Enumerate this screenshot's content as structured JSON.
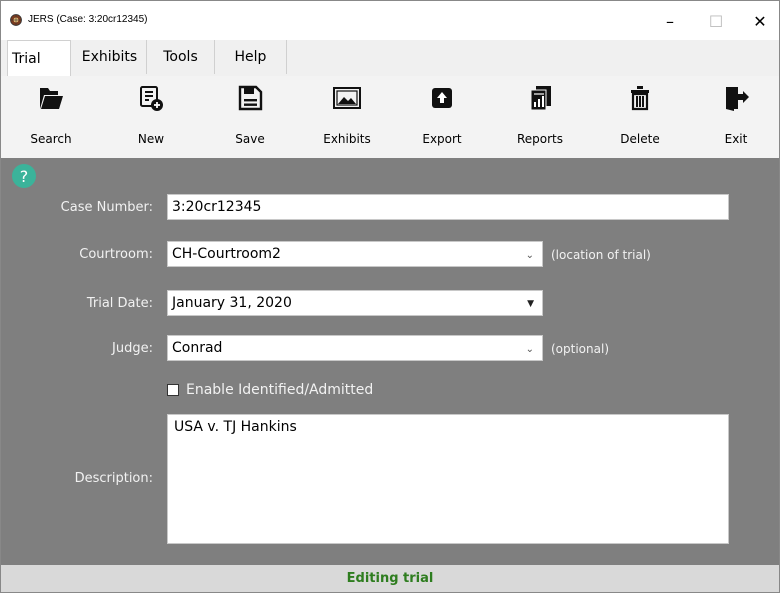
{
  "window": {
    "title": "JERS (Case: 3:20cr12345)",
    "minimize_glyph": "–",
    "maximize_glyph": "☐",
    "close_glyph": "✕"
  },
  "menu": {
    "items": [
      {
        "label": "Trial",
        "active": true
      },
      {
        "label": "Exhibits",
        "active": false
      },
      {
        "label": "Tools",
        "active": false
      },
      {
        "label": "Help",
        "active": false
      }
    ]
  },
  "toolbar": {
    "buttons": [
      {
        "label": "Search",
        "icon": "folder-open-icon"
      },
      {
        "label": "New",
        "icon": "new-document-icon"
      },
      {
        "label": "Save",
        "icon": "floppy-disk-icon"
      },
      {
        "label": "Exhibits",
        "icon": "image-icon"
      },
      {
        "label": "Export",
        "icon": "export-box-icon"
      },
      {
        "label": "Reports",
        "icon": "reports-icon"
      },
      {
        "label": "Delete",
        "icon": "trash-icon"
      },
      {
        "label": "Exit",
        "icon": "exit-door-icon"
      }
    ]
  },
  "form": {
    "help_glyph": "?",
    "case_number_label": "Case Number:",
    "case_number_value": "3:20cr12345",
    "courtroom_label": "Courtroom:",
    "courtroom_value": "CH-Courtroom2",
    "courtroom_hint": "(location of trial)",
    "trial_date_label": "Trial Date:",
    "trial_date_value": "January 31, 2020",
    "judge_label": "Judge:",
    "judge_value": "Conrad",
    "judge_hint": "(optional)",
    "enable_checkbox_label": "Enable Identified/Admitted",
    "enable_checked": false,
    "description_label": "Description:",
    "description_value": "USA v. TJ Hankins"
  },
  "status": {
    "text": "Editing trial",
    "color": "#2e7d1f"
  },
  "colors": {
    "form_background": "#7f7f7f",
    "help_icon": "#3bb39a",
    "toolbar_background": "#f3f3f3"
  }
}
